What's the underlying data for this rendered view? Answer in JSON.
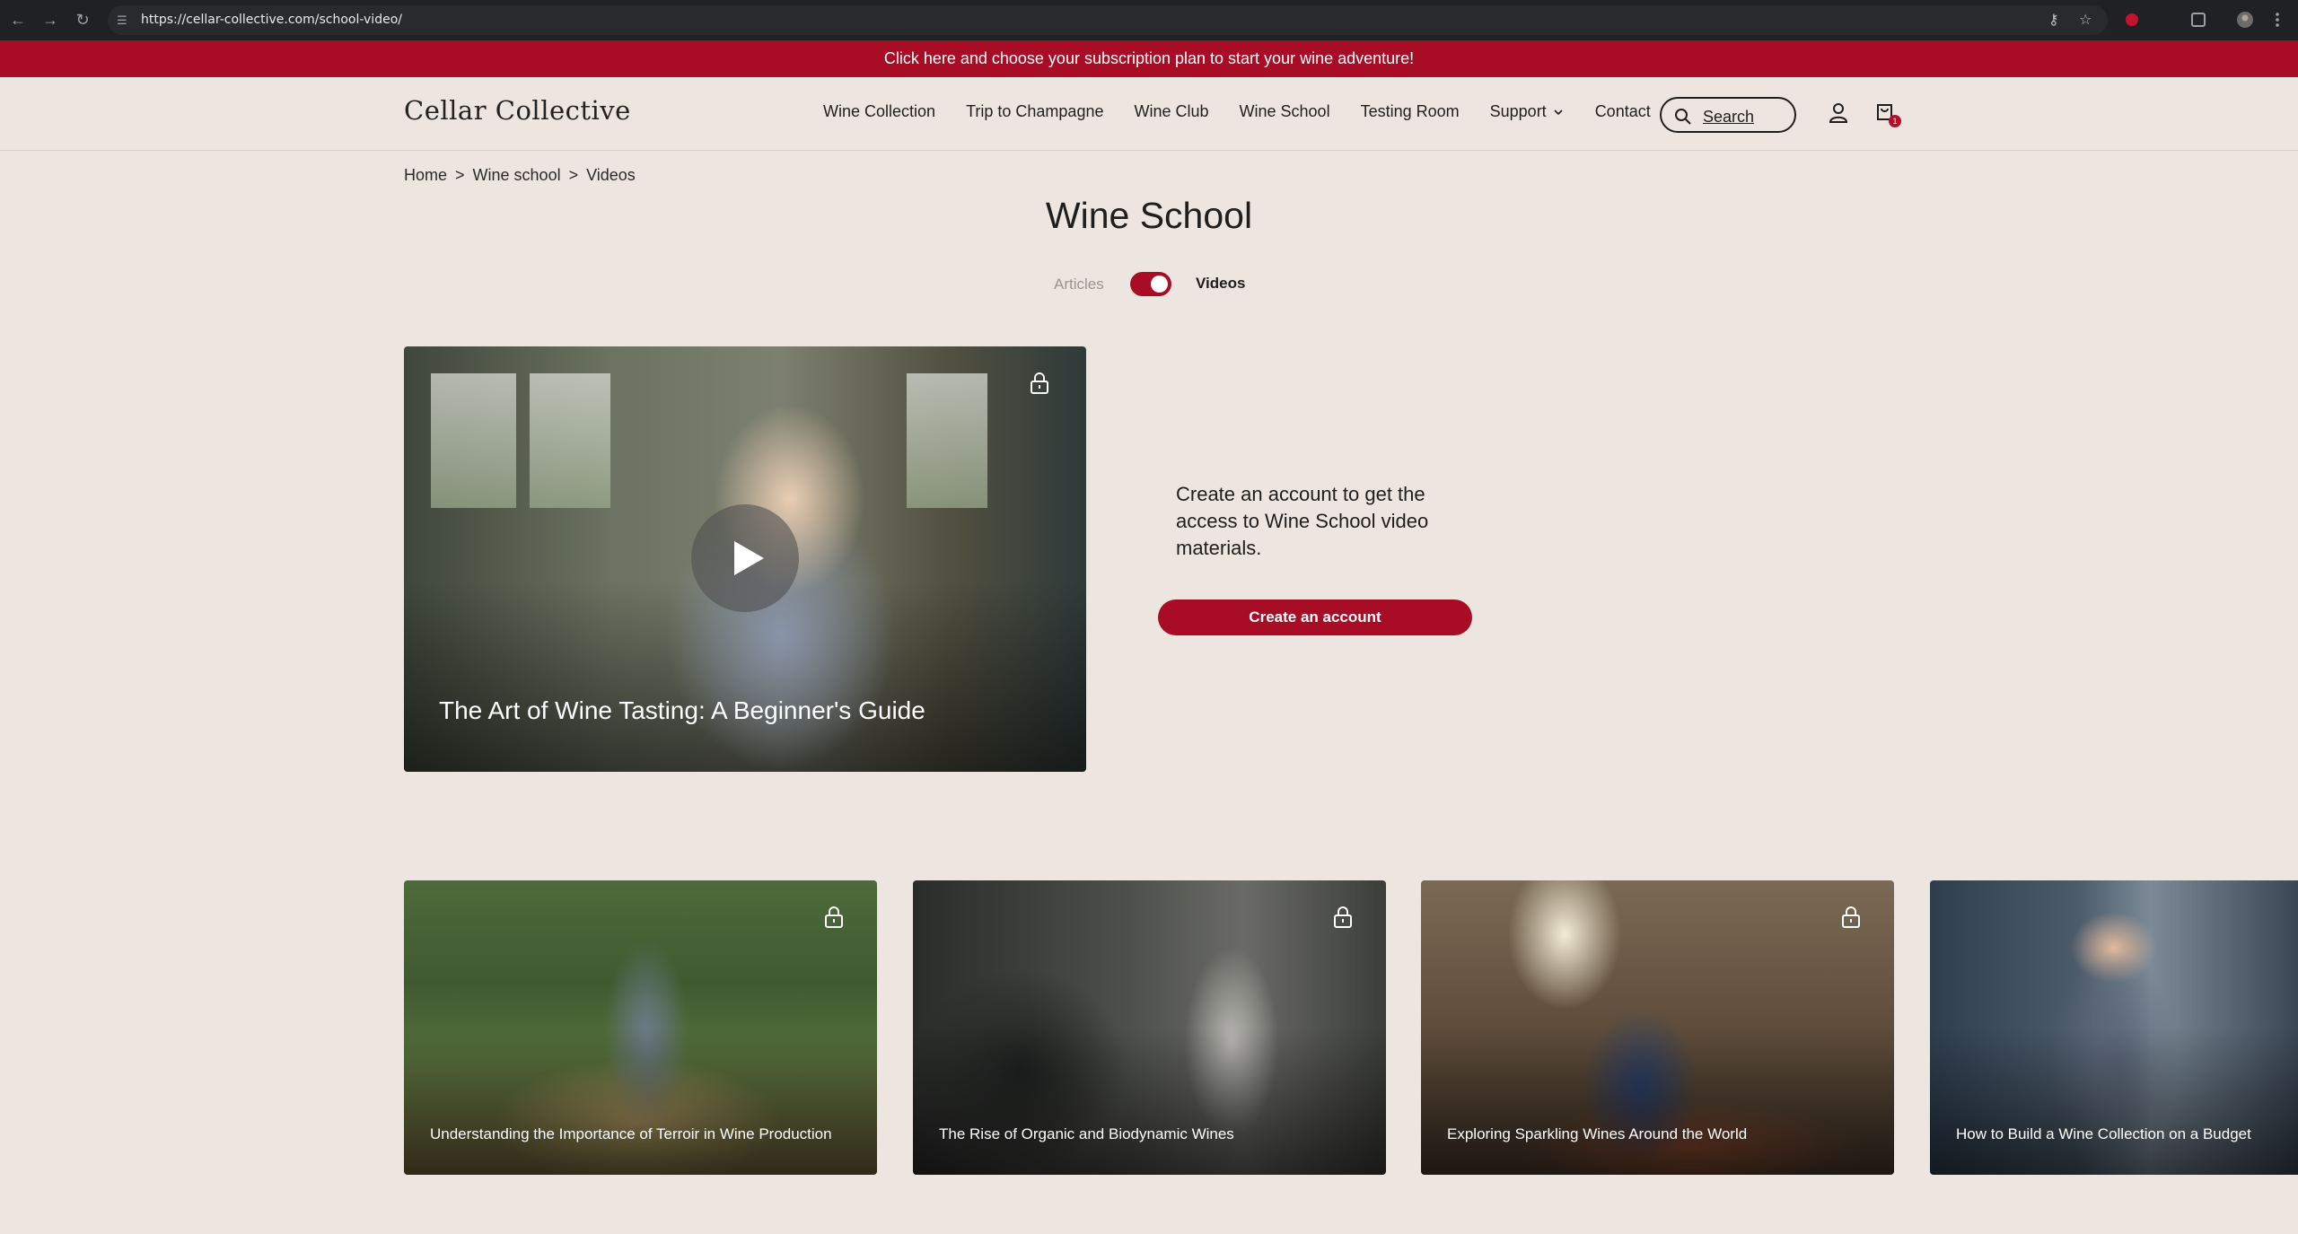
{
  "browser": {
    "url": "https://cellar-collective.com/school-video/"
  },
  "promo": {
    "text": "Click here and choose your subscription plan to start your wine adventure!"
  },
  "header": {
    "logo": "Cellar Collective",
    "nav": [
      "Wine Collection",
      "Trip to Champagne",
      "Wine Club",
      "Wine School",
      "Testing Room",
      "Support",
      "Contact"
    ],
    "search_label": "Search",
    "cart_count": "1"
  },
  "breadcrumb": [
    "Home",
    "Wine school",
    "Videos"
  ],
  "breadcrumb_sep": ">",
  "page": {
    "title": "Wine School",
    "toggle_left": "Articles",
    "toggle_right": "Videos"
  },
  "featured": {
    "title": "The Art of Wine Tasting: A Beginner's Guide"
  },
  "cta": {
    "text": "Create an account to get the access to Wine School video materials.",
    "button": "Create an account"
  },
  "videos": [
    {
      "title": "Understanding the Importance of Terroir in Wine Production"
    },
    {
      "title": "The Rise of Organic and Biodynamic Wines"
    },
    {
      "title": "Exploring Sparkling Wines Around the World"
    },
    {
      "title": "How to Build a Wine Collection on a Budget"
    }
  ],
  "colors": {
    "accent": "#a80d25",
    "background": "#ede6e0"
  },
  "icons": {
    "lock": "lock-icon",
    "play": "play-icon",
    "account": "account-icon",
    "cart": "cart-icon",
    "search": "search-icon"
  }
}
